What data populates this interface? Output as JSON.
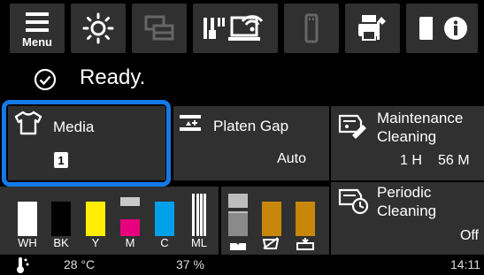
{
  "toolbar": {
    "menu_label": "Menu",
    "buttons": [
      {
        "name": "menu-icon"
      },
      {
        "name": "brightness-icon"
      },
      {
        "name": "print-queue-icon"
      },
      {
        "name": "network-icon"
      },
      {
        "name": "usb-icon"
      },
      {
        "name": "maintenance-printer-icon"
      },
      {
        "name": "manual-book-icon"
      },
      {
        "name": "info-icon"
      }
    ]
  },
  "status": {
    "text": "Ready.",
    "icon": "check-circle-icon"
  },
  "media": {
    "label": "Media",
    "slot": "1",
    "icon": "tshirt-icon"
  },
  "platen_gap": {
    "label": "Platen Gap",
    "value": "Auto",
    "icon": "platen-gap-icon"
  },
  "maintenance_cleaning": {
    "label_line1": "Maintenance",
    "label_line2": "Cleaning",
    "hours": "1 H",
    "minutes": "56 M",
    "icon": "maintenance-cleaning-icon"
  },
  "periodic_cleaning": {
    "label_line1": "Periodic",
    "label_line2": "Cleaning",
    "value": "Off",
    "icon": "periodic-cleaning-icon"
  },
  "inks": [
    {
      "label": "WH",
      "color": "#ffffff",
      "level": 0.82
    },
    {
      "label": "BK",
      "color": "#000000",
      "level": 0.82
    },
    {
      "label": "Y",
      "color": "#ffee00",
      "level": 0.82
    },
    {
      "label": "M",
      "color": "#e6007e",
      "level": 0.4
    },
    {
      "label": "C",
      "color": "#00a0e9",
      "level": 0.82
    },
    {
      "label": "ML",
      "color": "#ffffff",
      "level": 1.0
    }
  ],
  "waste": [
    {
      "name": "waste-ink-bottle-icon",
      "level": 0.55
    },
    {
      "name": "maintenance-box-icon",
      "level": 0.82
    },
    {
      "name": "cleaning-kit-icon",
      "level": 0.82
    }
  ],
  "bottom": {
    "temperature": "28 °C",
    "humidity": "37 %",
    "time": "14:11"
  },
  "colors": {
    "accent": "#1479e8",
    "panel": "#303030",
    "waste_fill": "#c8860a"
  }
}
